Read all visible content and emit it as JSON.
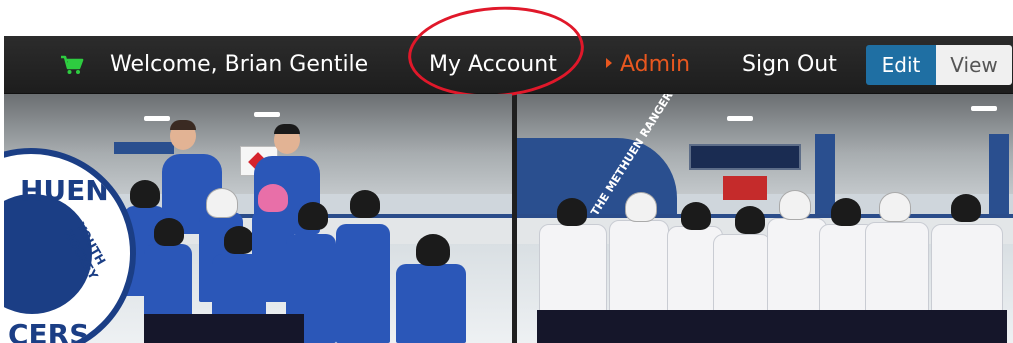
{
  "topbar": {
    "cart_icon": "shopping-cart-icon",
    "welcome_text": "Welcome, Brian Gentile",
    "my_account": "My Account",
    "admin": "Admin",
    "sign_out": "Sign Out",
    "edit": "Edit",
    "view": "View"
  },
  "photos": {
    "left": {
      "logo_text_top": "HUEN",
      "logo_text_side": "YOUTH HOCKEY",
      "logo_text_bottom": "CERS"
    },
    "right": {
      "banner_text": "HOME OF THE METHUEN RANGERS"
    }
  },
  "colors": {
    "topbar_bg": "#262626",
    "admin": "#e8571f",
    "edit_active": "#1f6fa3",
    "annotation_circle": "#e0182a",
    "cart": "#2ecc40"
  }
}
